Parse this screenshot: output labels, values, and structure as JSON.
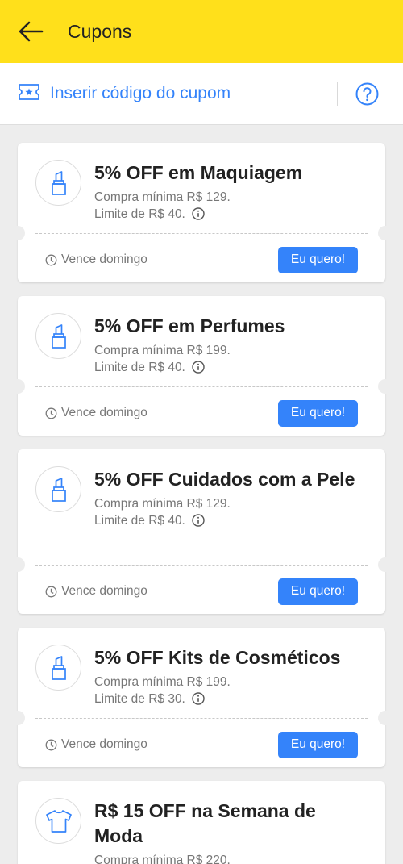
{
  "header": {
    "title": "Cupons",
    "back_icon": "back-arrow-icon",
    "background": "#ffe01b"
  },
  "code_bar": {
    "label": "Inserir código do cupom",
    "icon": "ticket-star-icon",
    "help_icon": "help-circle-icon",
    "accent": "#3483fa"
  },
  "coupons": [
    {
      "title": "5% OFF em Maquiagem",
      "min_purchase": "Compra mínima R$ 129.",
      "limit": "Limite de R$ 40.",
      "expiry": "Vence domingo",
      "button": "Eu quero!",
      "icon": "lipstick-icon"
    },
    {
      "title": "5% OFF em Perfumes",
      "min_purchase": "Compra mínima R$ 199.",
      "limit": "Limite de R$ 40.",
      "expiry": "Vence domingo",
      "button": "Eu quero!",
      "icon": "lipstick-icon"
    },
    {
      "title": "5% OFF Cuidados com a Pele",
      "min_purchase": "Compra mínima R$ 129.",
      "limit": "Limite de R$ 40.",
      "expiry": "Vence domingo",
      "button": "Eu quero!",
      "icon": "lipstick-icon"
    },
    {
      "title": "5% OFF Kits de Cosméticos",
      "min_purchase": "Compra mínima R$ 199.",
      "limit": "Limite de R$ 30.",
      "expiry": "Vence domingo",
      "button": "Eu quero!",
      "icon": "lipstick-icon"
    },
    {
      "title": "R$ 15 OFF na Semana de Moda",
      "min_purchase": "Compra mínima R$ 220.",
      "icon": "tshirt-icon"
    }
  ]
}
